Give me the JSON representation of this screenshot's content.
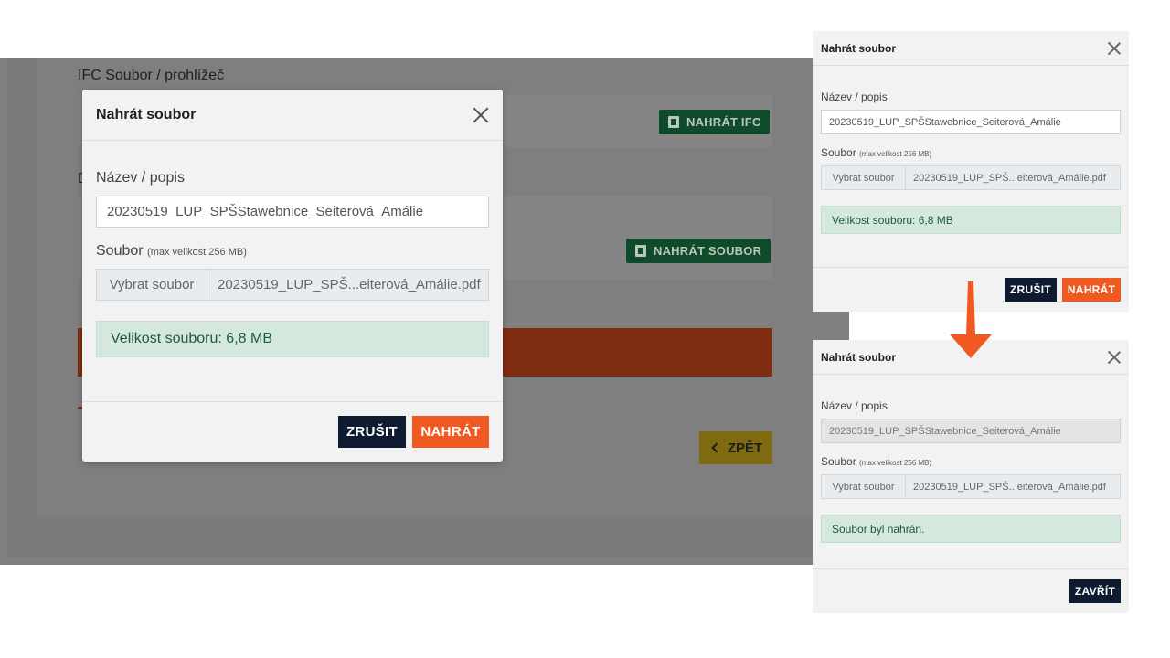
{
  "background": {
    "section_title": "IFC Soubor / prohlížeč",
    "letter": "D",
    "upload_ifc_label": "NAHRÁT IFC",
    "upload_file_label": "NAHRÁT SOUBOR",
    "back_label": "ZPĚT"
  },
  "modal": {
    "title": "Nahrát soubor",
    "name_label": "Název / popis",
    "name_value": "20230519_LUP_SPŠStawebnice_Seiterová_Amálie",
    "file_label": "Soubor",
    "file_hint": "(max velikost 256 MB)",
    "choose_file_label": "Vybrat soubor",
    "file_name": "20230519_LUP_SPŠ...eiterová_Amálie.pdf",
    "info": "Velikost souboru: 6,8 MB",
    "cancel_label": "ZRUŠIT",
    "upload_label": "NAHRÁT"
  },
  "panel_before": {
    "title": "Nahrát soubor",
    "name_label": "Název / popis",
    "name_value": "20230519_LUP_SPŠStawebnice_Seiterová_Amálie",
    "file_label": "Soubor",
    "file_hint": "(max velikost 256 MB)",
    "choose_file_label": "Vybrat soubor",
    "file_name": "20230519_LUP_SPŠ...eiterová_Amálie.pdf",
    "info": "Velikost souboru: 6,8 MB",
    "cancel_label": "ZRUŠIT",
    "upload_label": "NAHRÁT"
  },
  "panel_after": {
    "title": "Nahrát soubor",
    "name_label": "Název / popis",
    "name_value": "20230519_LUP_SPŠStawebnice_Seiterová_Amálie",
    "file_label": "Soubor",
    "file_hint": "(max velikost 256 MB)",
    "choose_file_label": "Vybrat soubor",
    "file_name": "20230519_LUP_SPŠ...eiterová_Amálie.pdf",
    "info": "Soubor byl nahrán.",
    "close_label": "ZAVŘÍT"
  },
  "colors": {
    "accent_orange": "#f05a22",
    "dark_navy": "#0e1a30",
    "success_bg": "#d4e8de",
    "success_text": "#1e5a3c"
  }
}
